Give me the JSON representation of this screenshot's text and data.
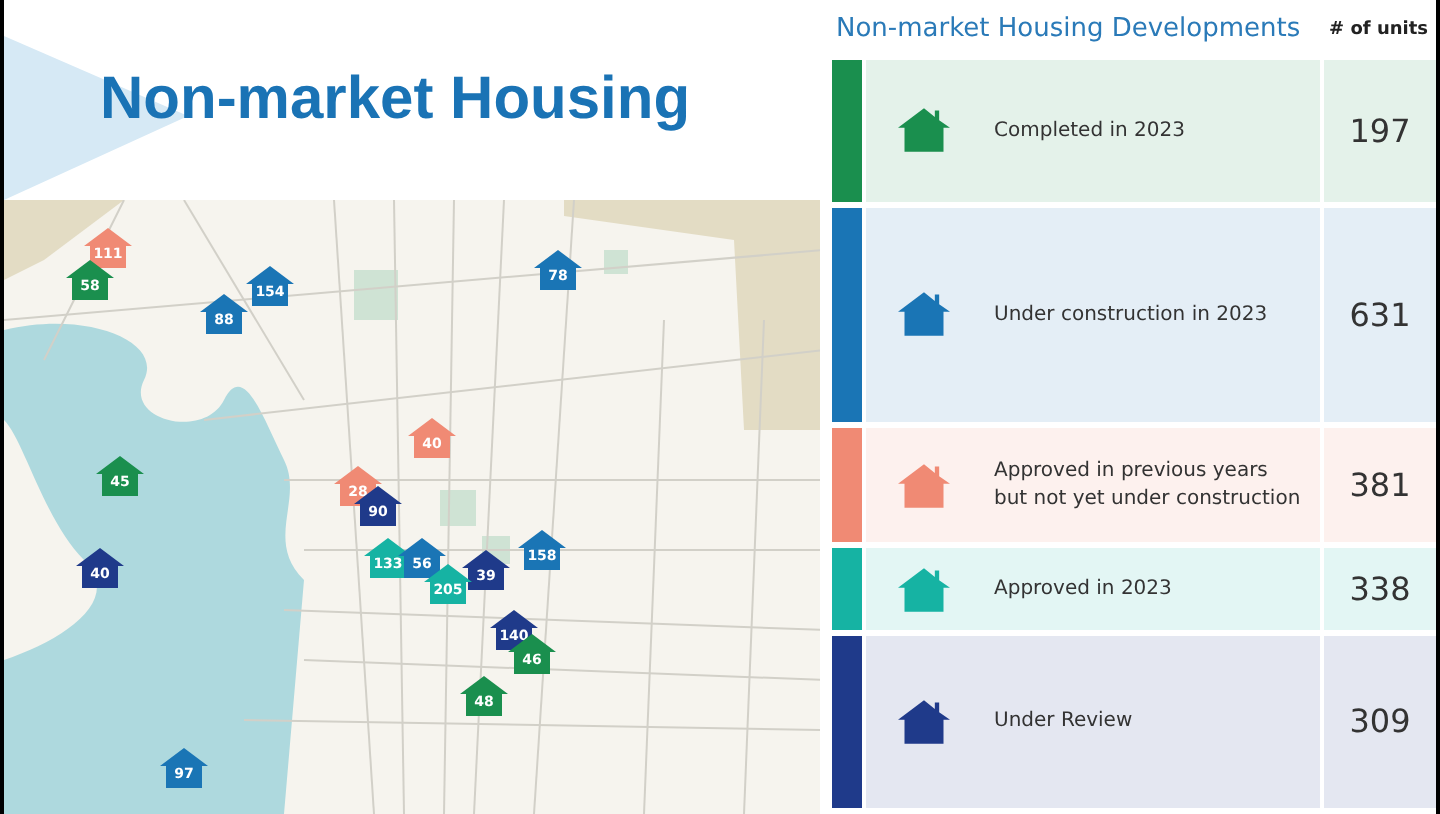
{
  "title": "Non-market Housing",
  "legend": {
    "title": "Non-market Housing Developments",
    "units_heading": "# of units",
    "rows": [
      {
        "label": "Completed in 2023",
        "units": "197",
        "color": "#1a8f4e"
      },
      {
        "label": "Under construction in 2023",
        "units": "631",
        "color": "#1a75b5"
      },
      {
        "label": "Approved in previous years\nbut not yet under construction",
        "units": "381",
        "color": "#f08a74"
      },
      {
        "label": "Approved in 2023",
        "units": "338",
        "color": "#16b3a3"
      },
      {
        "label": "Under Review",
        "units": "309",
        "color": "#1f3a8a"
      }
    ]
  },
  "map": {
    "pins": [
      {
        "label": "111",
        "color": "#f08a74"
      },
      {
        "label": "58",
        "color": "#1a8f4e"
      },
      {
        "label": "154",
        "color": "#1a75b5"
      },
      {
        "label": "88",
        "color": "#1a75b5"
      },
      {
        "label": "78",
        "color": "#1a75b5"
      },
      {
        "label": "40",
        "color": "#f08a74"
      },
      {
        "label": "45",
        "color": "#1a8f4e"
      },
      {
        "label": "28",
        "color": "#f08a74"
      },
      {
        "label": "90",
        "color": "#1f3a8a"
      },
      {
        "label": "40",
        "color": "#1f3a8a"
      },
      {
        "label": "133",
        "color": "#16b3a3"
      },
      {
        "label": "56",
        "color": "#1a75b5"
      },
      {
        "label": "39",
        "color": "#1f3a8a"
      },
      {
        "label": "205",
        "color": "#16b3a3"
      },
      {
        "label": "158",
        "color": "#1a75b5"
      },
      {
        "label": "140",
        "color": "#1f3a8a"
      },
      {
        "label": "46",
        "color": "#1a8f4e"
      },
      {
        "label": "48",
        "color": "#1a8f4e"
      },
      {
        "label": "97",
        "color": "#1a75b5"
      }
    ]
  }
}
